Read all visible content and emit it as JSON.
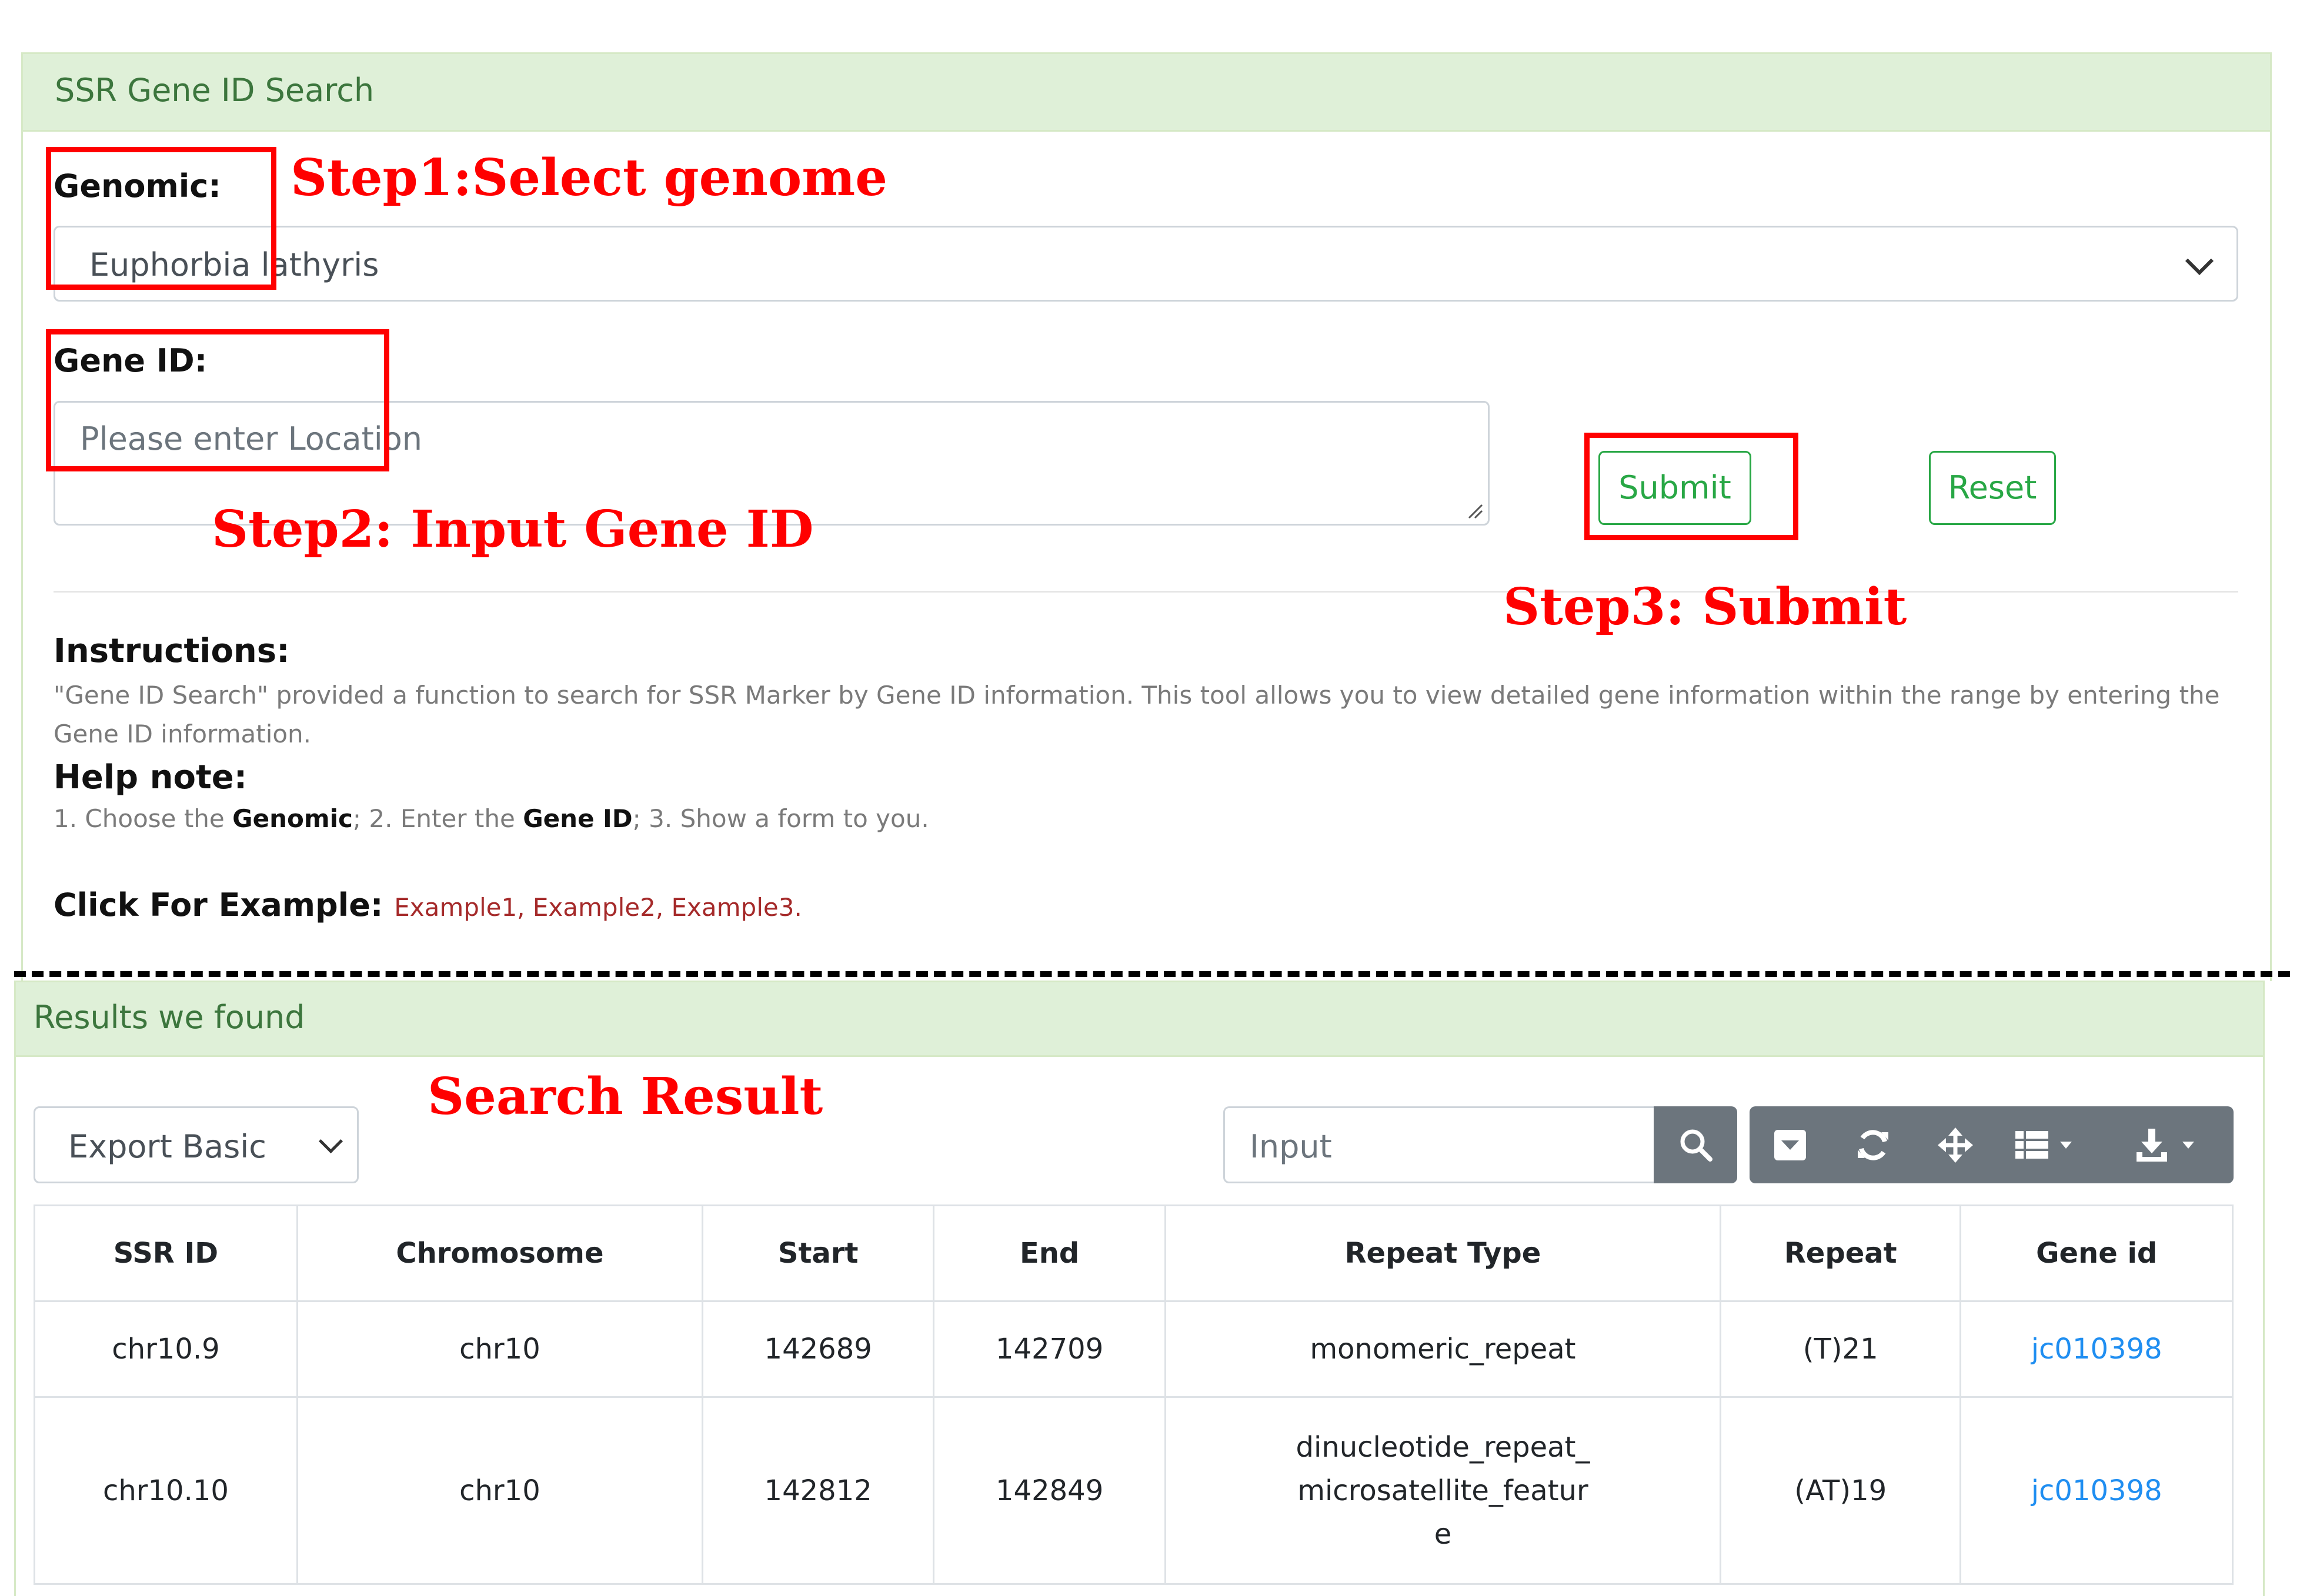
{
  "search_panel": {
    "title": "SSR Gene ID Search",
    "genomic_label": "Genomic:",
    "genomic_value": "Euphorbia lathyris",
    "gene_id_label": "Gene ID:",
    "gene_id_placeholder": "Please enter Location",
    "submit_label": "Submit",
    "reset_label": "Reset",
    "instructions_title": "Instructions:",
    "instructions_text": "\"Gene ID Search\" provided a function to search for SSR Marker by Gene ID information. This tool allows you to view detailed gene information within the range by entering the Gene ID information.",
    "help_title": "Help note:",
    "help_parts": [
      "1. Choose the ",
      "Genomic",
      "; 2. Enter the ",
      "Gene ID",
      "; 3. Show a form to you."
    ],
    "example_label": "Click For Example:",
    "examples": [
      "Example1",
      "Example2",
      "Example3"
    ],
    "example_seps": [
      ", ",
      ", ",
      "."
    ]
  },
  "annotations": {
    "step1": "Step1:Select genome",
    "step2": "Step2:   Input Gene ID",
    "step3": "Step3:   Submit",
    "search_result": "Search Result"
  },
  "results_panel": {
    "title": "Results we found",
    "export_value": "Export Basic",
    "search_placeholder": "Input",
    "toolbar_icons": [
      "search-icon",
      "toggle-icon",
      "refresh-icon",
      "move-icon",
      "columns-icon",
      "download-icon"
    ],
    "columns": [
      "SSR ID",
      "Chromosome",
      "Start",
      "End",
      "Repeat Type",
      "Repeat",
      "Gene id"
    ],
    "rows": [
      [
        "chr10.9",
        "chr10",
        "142689",
        "142709",
        "monomeric_repeat",
        "(T)21",
        "jc010398"
      ],
      [
        "chr10.10",
        "chr10",
        "142812",
        "142849",
        "dinucleotide_repeat_microsatellite_feature",
        "(AT)19",
        "jc010398"
      ]
    ],
    "row2_repeat_type_lines": [
      "dinucleotide_repeat_",
      "microsatellite_featur",
      "e"
    ]
  },
  "colors": {
    "panel_header_bg": "#dff0d8",
    "panel_title": "#3c763d",
    "success": "#28a745",
    "annotation_red": "#ff0000",
    "example_link": "#a52a2a",
    "gene_link": "#1f8ef1",
    "toolbar_bg": "#6c757d"
  }
}
